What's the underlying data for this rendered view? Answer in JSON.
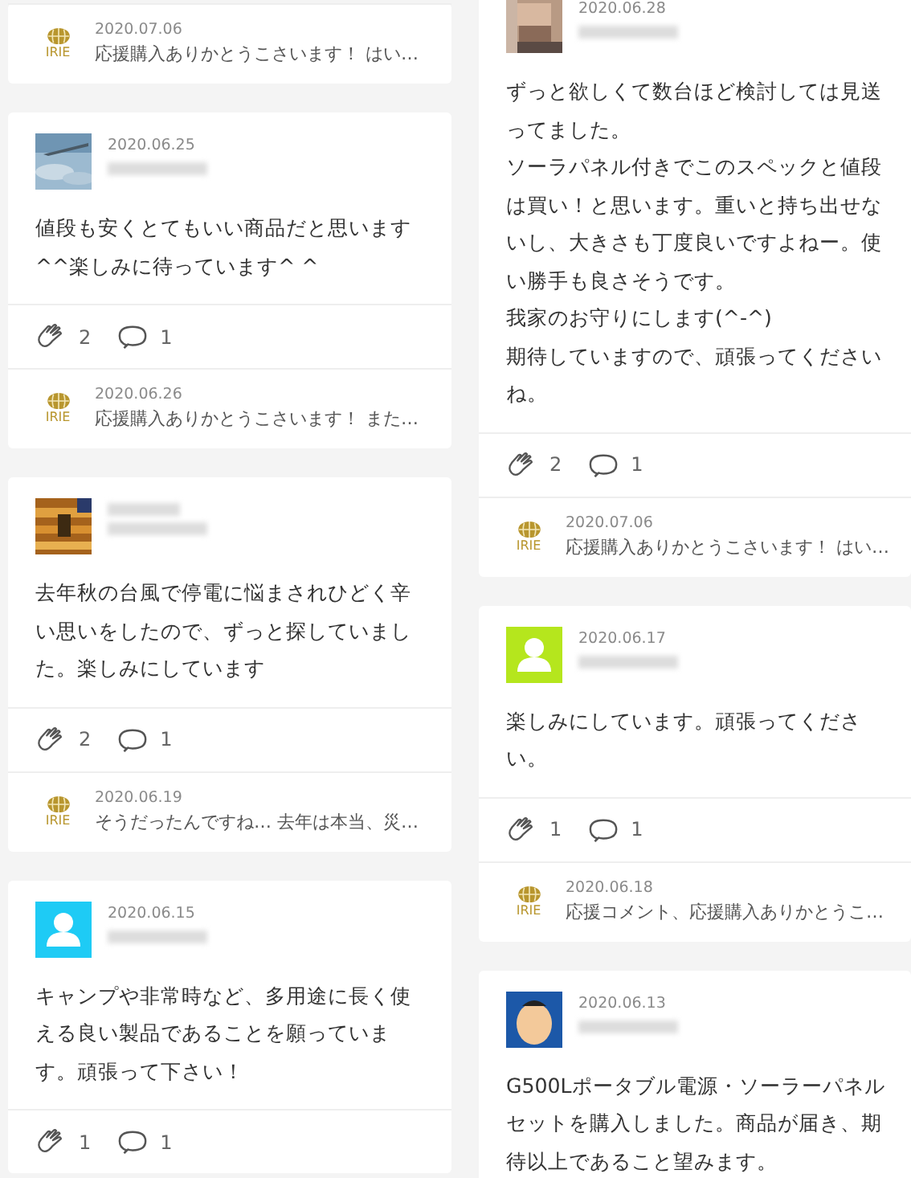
{
  "columns": [
    {
      "cards": [
        {
          "reply": {
            "logo": "IRIE",
            "date": "2020.07.06",
            "text": "応援購入ありかとうこさいます！ はい…"
          }
        },
        {
          "date": "2020.06.25",
          "body": "値段も安くとてもいい商品だと思います^^楽しみに待っています^ ^",
          "likes": "2",
          "comments": "1",
          "reply": {
            "logo": "IRIE",
            "date": "2020.06.26",
            "text": "応援購入ありかとうこさいます！ また…"
          }
        },
        {
          "body": "去年秋の台風で停電に悩まされひどく辛い思いをしたので、ずっと探していました。楽しみにしています",
          "likes": "2",
          "comments": "1",
          "reply": {
            "logo": "IRIE",
            "date": "2020.06.19",
            "text": "そうだったんですね… 去年は本当、災…"
          }
        },
        {
          "avatar": {
            "kind": "default",
            "color": "#1ecbf5"
          },
          "date": "2020.06.15",
          "body": "キャンプや非常時など、多用途に長く使える良い製品であることを願っています。頑張って下さい！",
          "likes": "1",
          "comments": "1"
        }
      ]
    },
    {
      "cards": [
        {
          "date": "2020.06.28",
          "body": [
            "ずっと欲しくて数台ほど検討しては見送ってました。",
            "ソーラパネル付きでこのスペックと値段は買い！と思います。重いと持ち出せないし、大きさも丁度良いですよねー。使い勝手も良さそうです。",
            "我家のお守りにします(^-^)",
            "期待していますので、頑張ってくださいね。"
          ],
          "likes": "2",
          "comments": "1",
          "reply": {
            "logo": "IRIE",
            "date": "2020.07.06",
            "text": "応援購入ありかとうこさいます！ はい…"
          }
        },
        {
          "avatar": {
            "kind": "default",
            "color": "#b5e61d"
          },
          "date": "2020.06.17",
          "body": "楽しみにしています。頑張ってください。",
          "likes": "1",
          "comments": "1",
          "reply": {
            "logo": "IRIE",
            "date": "2020.06.18",
            "text": "応援コメント、応援購入ありかとうこ…"
          }
        },
        {
          "avatar": {
            "kind": "cartoon"
          },
          "date": "2020.06.13",
          "body": "G500Lポータブル電源・ソーラーパネルセットを購入しました。商品が届き、期待以上であること望みます。"
        }
      ]
    }
  ]
}
